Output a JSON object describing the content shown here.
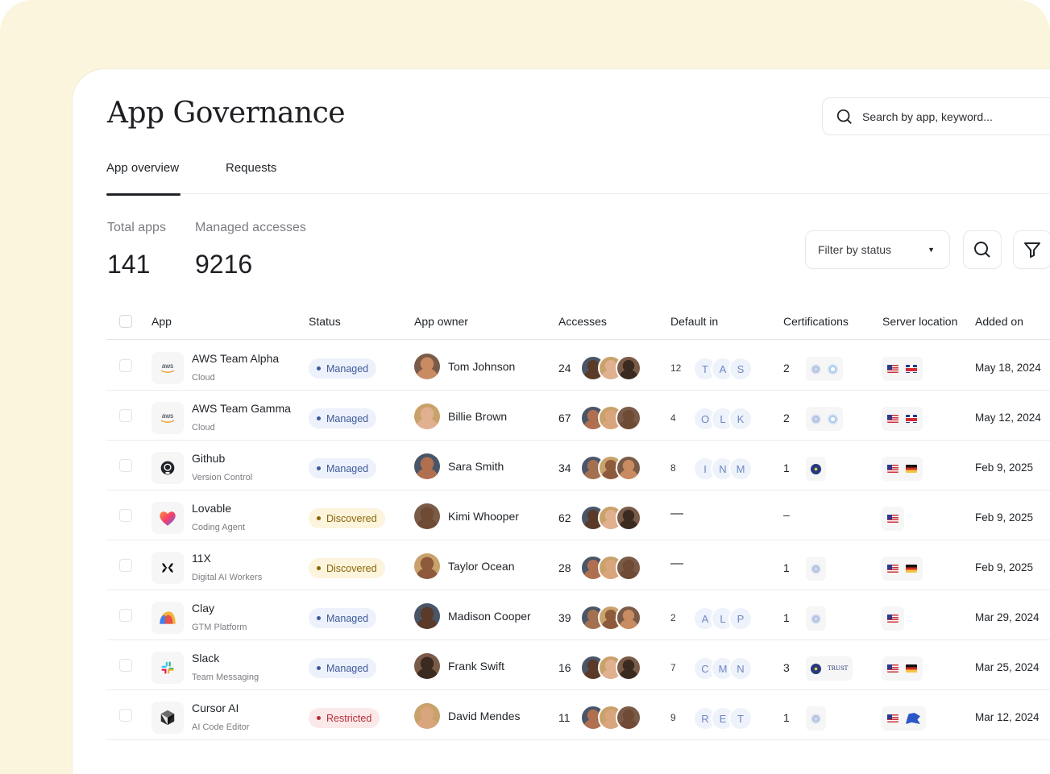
{
  "page": {
    "title": "App Governance"
  },
  "search": {
    "placeholder": "Search by app, keyword..."
  },
  "tabs": [
    {
      "label": "App overview",
      "active": true
    },
    {
      "label": "Requests",
      "active": false
    }
  ],
  "stats": {
    "total_apps": {
      "label": "Total apps",
      "value": "141"
    },
    "managed_accesses": {
      "label": "Managed accesses",
      "value": "9216"
    }
  },
  "filter": {
    "label": "Filter by status"
  },
  "table": {
    "columns": [
      "App",
      "Status",
      "App owner",
      "Accesses",
      "Default in",
      "Certifications",
      "Server location",
      "Added on"
    ],
    "rows": [
      {
        "app": "AWS Team Alpha",
        "category": "Cloud",
        "logo": "aws-logo",
        "status": "Managed",
        "owner": "Tom Johnson",
        "accesses": "24",
        "default_count": "12",
        "default_chips": [
          "T",
          "A",
          "S"
        ],
        "certifications": "2",
        "certs": [
          "soc",
          "iso"
        ],
        "locations": [
          "us",
          "uk"
        ],
        "added": "May 18, 2024"
      },
      {
        "app": "AWS Team Gamma",
        "category": "Cloud",
        "logo": "aws-logo",
        "status": "Managed",
        "owner": "Billie Brown",
        "accesses": "67",
        "default_count": "4",
        "default_chips": [
          "O",
          "L",
          "K"
        ],
        "certifications": "2",
        "certs": [
          "soc",
          "iso"
        ],
        "locations": [
          "us",
          "uk"
        ],
        "added": "May 12, 2024"
      },
      {
        "app": "Github",
        "category": "Version Control",
        "logo": "github-logo",
        "status": "Managed",
        "owner": "Sara Smith",
        "accesses": "34",
        "default_count": "8",
        "default_chips": [
          "I",
          "N",
          "M"
        ],
        "certifications": "1",
        "certs": [
          "gdpr"
        ],
        "locations": [
          "us",
          "de"
        ],
        "added": "Feb 9, 2025"
      },
      {
        "app": "Lovable",
        "category": "Coding Agent",
        "logo": "lovable-logo",
        "status": "Discovered",
        "owner": "Kimi Whooper",
        "accesses": "62",
        "default_count": "—",
        "default_chips": [],
        "certifications": "–",
        "certs": [],
        "locations": [
          "us"
        ],
        "added": "Feb 9, 2025"
      },
      {
        "app": "11X",
        "category": "Digital AI Workers",
        "logo": "11x-logo",
        "status": "Discovered",
        "owner": "Taylor Ocean",
        "accesses": "28",
        "default_count": "—",
        "default_chips": [],
        "certifications": "1",
        "certs": [
          "soc"
        ],
        "locations": [
          "us",
          "de"
        ],
        "added": "Feb 9, 2025"
      },
      {
        "app": "Clay",
        "category": "GTM Platform",
        "logo": "clay-logo",
        "status": "Managed",
        "owner": "Madison Cooper",
        "accesses": "39",
        "default_count": "2",
        "default_chips": [
          "A",
          "L",
          "P"
        ],
        "certifications": "1",
        "certs": [
          "soc"
        ],
        "locations": [
          "us"
        ],
        "added": "Mar 29, 2024"
      },
      {
        "app": "Slack",
        "category": "Team Messaging",
        "logo": "slack-logo",
        "status": "Managed",
        "owner": "Frank Swift",
        "accesses": "16",
        "default_count": "7",
        "default_chips": [
          "C",
          "M",
          "N"
        ],
        "certifications": "3",
        "certs": [
          "gdpr",
          "trust"
        ],
        "locations": [
          "us",
          "de"
        ],
        "added": "Mar 25, 2024"
      },
      {
        "app": "Cursor AI",
        "category": "AI Code Editor",
        "logo": "cursor-logo",
        "status": "Restricted",
        "owner": "David Mendes",
        "accesses": "11",
        "default_count": "9",
        "default_chips": [
          "R",
          "E",
          "T"
        ],
        "certifications": "1",
        "certs": [
          "soc"
        ],
        "locations": [
          "us",
          "eu"
        ],
        "added": "Mar 12, 2024"
      }
    ]
  },
  "cert_labels": {
    "trust": "TRUST"
  },
  "colors": {
    "managed": "#3e5a98",
    "discovered": "#8a6508",
    "restricted": "#b72d35",
    "background": "#fbf5de"
  }
}
